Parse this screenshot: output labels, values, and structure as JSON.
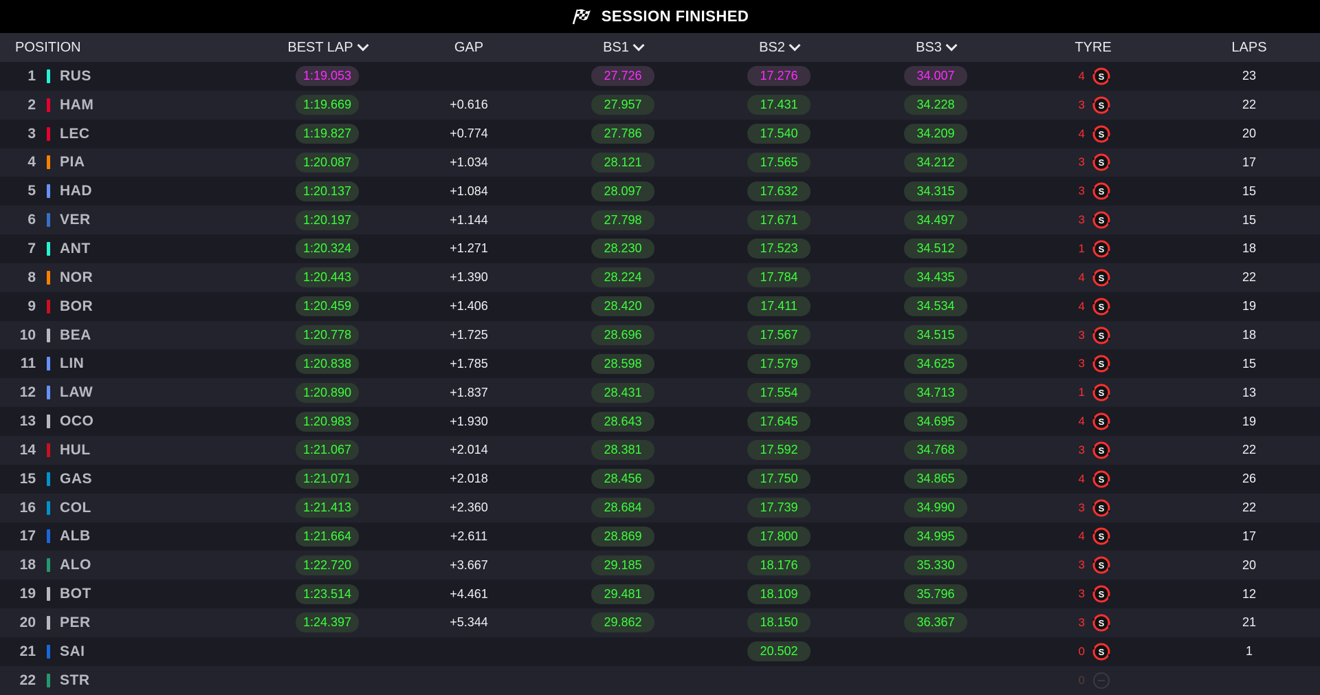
{
  "title": "SESSION FINISHED",
  "columns": {
    "position": "POSITION",
    "best_lap": "BEST LAP",
    "gap": "GAP",
    "bs1": "BS1",
    "bs2": "BS2",
    "bs3": "BS3",
    "tyre": "TYRE",
    "laps": "LAPS"
  },
  "colors": {
    "purple": "#ff2bff",
    "green": "#3cff3c",
    "tyre_red": "#ff3030"
  },
  "rows": [
    {
      "pos": "1",
      "driver": "RUS",
      "team_color": "#27f4d2",
      "best": "1:19.053",
      "best_style": "purple",
      "gap": "",
      "bs1": "27.726",
      "bs1_style": "purple",
      "bs2": "17.276",
      "bs2_style": "purple",
      "bs3": "34.007",
      "bs3_style": "purple",
      "tyre_laps": "4",
      "tyre": "S",
      "laps": "23"
    },
    {
      "pos": "2",
      "driver": "HAM",
      "team_color": "#e8002d",
      "best": "1:19.669",
      "best_style": "green",
      "gap": "+0.616",
      "bs1": "27.957",
      "bs1_style": "green",
      "bs2": "17.431",
      "bs2_style": "green",
      "bs3": "34.228",
      "bs3_style": "green",
      "tyre_laps": "3",
      "tyre": "S",
      "laps": "22"
    },
    {
      "pos": "3",
      "driver": "LEC",
      "team_color": "#e8002d",
      "best": "1:19.827",
      "best_style": "green",
      "gap": "+0.774",
      "bs1": "27.786",
      "bs1_style": "green",
      "bs2": "17.540",
      "bs2_style": "green",
      "bs3": "34.209",
      "bs3_style": "green",
      "tyre_laps": "4",
      "tyre": "S",
      "laps": "20"
    },
    {
      "pos": "4",
      "driver": "PIA",
      "team_color": "#ff8000",
      "best": "1:20.087",
      "best_style": "green",
      "gap": "+1.034",
      "bs1": "28.121",
      "bs1_style": "green",
      "bs2": "17.565",
      "bs2_style": "green",
      "bs3": "34.212",
      "bs3_style": "green",
      "tyre_laps": "3",
      "tyre": "S",
      "laps": "17"
    },
    {
      "pos": "5",
      "driver": "HAD",
      "team_color": "#6692ff",
      "best": "1:20.137",
      "best_style": "green",
      "gap": "+1.084",
      "bs1": "28.097",
      "bs1_style": "green",
      "bs2": "17.632",
      "bs2_style": "green",
      "bs3": "34.315",
      "bs3_style": "green",
      "tyre_laps": "3",
      "tyre": "S",
      "laps": "15"
    },
    {
      "pos": "6",
      "driver": "VER",
      "team_color": "#3671c6",
      "best": "1:20.197",
      "best_style": "green",
      "gap": "+1.144",
      "bs1": "27.798",
      "bs1_style": "green",
      "bs2": "17.671",
      "bs2_style": "green",
      "bs3": "34.497",
      "bs3_style": "green",
      "tyre_laps": "3",
      "tyre": "S",
      "laps": "15"
    },
    {
      "pos": "7",
      "driver": "ANT",
      "team_color": "#27f4d2",
      "best": "1:20.324",
      "best_style": "green",
      "gap": "+1.271",
      "bs1": "28.230",
      "bs1_style": "green",
      "bs2": "17.523",
      "bs2_style": "green",
      "bs3": "34.512",
      "bs3_style": "green",
      "tyre_laps": "1",
      "tyre": "S",
      "laps": "18"
    },
    {
      "pos": "8",
      "driver": "NOR",
      "team_color": "#ff8000",
      "best": "1:20.443",
      "best_style": "green",
      "gap": "+1.390",
      "bs1": "28.224",
      "bs1_style": "green",
      "bs2": "17.784",
      "bs2_style": "green",
      "bs3": "34.435",
      "bs3_style": "green",
      "tyre_laps": "4",
      "tyre": "S",
      "laps": "22"
    },
    {
      "pos": "9",
      "driver": "BOR",
      "team_color": "#cc1020",
      "best": "1:20.459",
      "best_style": "green",
      "gap": "+1.406",
      "bs1": "28.420",
      "bs1_style": "green",
      "bs2": "17.411",
      "bs2_style": "green",
      "bs3": "34.534",
      "bs3_style": "green",
      "tyre_laps": "4",
      "tyre": "S",
      "laps": "19"
    },
    {
      "pos": "10",
      "driver": "BEA",
      "team_color": "#b6babd",
      "best": "1:20.778",
      "best_style": "green",
      "gap": "+1.725",
      "bs1": "28.696",
      "bs1_style": "green",
      "bs2": "17.567",
      "bs2_style": "green",
      "bs3": "34.515",
      "bs3_style": "green",
      "tyre_laps": "3",
      "tyre": "S",
      "laps": "18"
    },
    {
      "pos": "11",
      "driver": "LIN",
      "team_color": "#6692ff",
      "best": "1:20.838",
      "best_style": "green",
      "gap": "+1.785",
      "bs1": "28.598",
      "bs1_style": "green",
      "bs2": "17.579",
      "bs2_style": "green",
      "bs3": "34.625",
      "bs3_style": "green",
      "tyre_laps": "3",
      "tyre": "S",
      "laps": "15"
    },
    {
      "pos": "12",
      "driver": "LAW",
      "team_color": "#6692ff",
      "best": "1:20.890",
      "best_style": "green",
      "gap": "+1.837",
      "bs1": "28.431",
      "bs1_style": "green",
      "bs2": "17.554",
      "bs2_style": "green",
      "bs3": "34.713",
      "bs3_style": "green",
      "tyre_laps": "1",
      "tyre": "S",
      "laps": "13"
    },
    {
      "pos": "13",
      "driver": "OCO",
      "team_color": "#b6babd",
      "best": "1:20.983",
      "best_style": "green",
      "gap": "+1.930",
      "bs1": "28.643",
      "bs1_style": "green",
      "bs2": "17.645",
      "bs2_style": "green",
      "bs3": "34.695",
      "bs3_style": "green",
      "tyre_laps": "4",
      "tyre": "S",
      "laps": "19"
    },
    {
      "pos": "14",
      "driver": "HUL",
      "team_color": "#cc1020",
      "best": "1:21.067",
      "best_style": "green",
      "gap": "+2.014",
      "bs1": "28.381",
      "bs1_style": "green",
      "bs2": "17.592",
      "bs2_style": "green",
      "bs3": "34.768",
      "bs3_style": "green",
      "tyre_laps": "3",
      "tyre": "S",
      "laps": "22"
    },
    {
      "pos": "15",
      "driver": "GAS",
      "team_color": "#0093cc",
      "best": "1:21.071",
      "best_style": "green",
      "gap": "+2.018",
      "bs1": "28.456",
      "bs1_style": "green",
      "bs2": "17.750",
      "bs2_style": "green",
      "bs3": "34.865",
      "bs3_style": "green",
      "tyre_laps": "4",
      "tyre": "S",
      "laps": "26"
    },
    {
      "pos": "16",
      "driver": "COL",
      "team_color": "#0093cc",
      "best": "1:21.413",
      "best_style": "green",
      "gap": "+2.360",
      "bs1": "28.684",
      "bs1_style": "green",
      "bs2": "17.739",
      "bs2_style": "green",
      "bs3": "34.990",
      "bs3_style": "green",
      "tyre_laps": "3",
      "tyre": "S",
      "laps": "22"
    },
    {
      "pos": "17",
      "driver": "ALB",
      "team_color": "#1868db",
      "best": "1:21.664",
      "best_style": "green",
      "gap": "+2.611",
      "bs1": "28.869",
      "bs1_style": "green",
      "bs2": "17.800",
      "bs2_style": "green",
      "bs3": "34.995",
      "bs3_style": "green",
      "tyre_laps": "4",
      "tyre": "S",
      "laps": "17"
    },
    {
      "pos": "18",
      "driver": "ALO",
      "team_color": "#229971",
      "best": "1:22.720",
      "best_style": "green",
      "gap": "+3.667",
      "bs1": "29.185",
      "bs1_style": "green",
      "bs2": "18.176",
      "bs2_style": "green",
      "bs3": "35.330",
      "bs3_style": "green",
      "tyre_laps": "3",
      "tyre": "S",
      "laps": "20"
    },
    {
      "pos": "19",
      "driver": "BOT",
      "team_color": "#b6babd",
      "best": "1:23.514",
      "best_style": "green",
      "gap": "+4.461",
      "bs1": "29.481",
      "bs1_style": "green",
      "bs2": "18.109",
      "bs2_style": "green",
      "bs3": "35.796",
      "bs3_style": "green",
      "tyre_laps": "3",
      "tyre": "S",
      "laps": "12"
    },
    {
      "pos": "20",
      "driver": "PER",
      "team_color": "#b6babd",
      "best": "1:24.397",
      "best_style": "green",
      "gap": "+5.344",
      "bs1": "29.862",
      "bs1_style": "green",
      "bs2": "18.150",
      "bs2_style": "green",
      "bs3": "36.367",
      "bs3_style": "green",
      "tyre_laps": "3",
      "tyre": "S",
      "laps": "21"
    },
    {
      "pos": "21",
      "driver": "SAI",
      "team_color": "#1868db",
      "best": "",
      "best_style": "blank",
      "gap": "",
      "bs1": "",
      "bs1_style": "blank",
      "bs2": "20.502",
      "bs2_style": "green",
      "bs3": "",
      "bs3_style": "blank",
      "tyre_laps": "0",
      "tyre": "S",
      "laps": "1"
    },
    {
      "pos": "22",
      "driver": "STR",
      "team_color": "#229971",
      "best": "",
      "best_style": "blank",
      "gap": "",
      "bs1": "",
      "bs1_style": "blank",
      "bs2": "",
      "bs2_style": "blank",
      "bs3": "",
      "bs3_style": "blank",
      "tyre_laps": "0",
      "tyre": "",
      "laps": ""
    }
  ]
}
